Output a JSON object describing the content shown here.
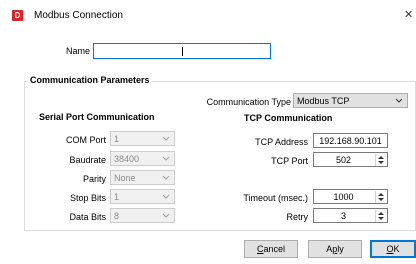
{
  "window": {
    "title": "Modbus Connection",
    "app_icon_letter": "D",
    "close_glyph": "✕"
  },
  "name_field": {
    "label": "Name",
    "value": ""
  },
  "comm_params": {
    "title": "Communication Parameters",
    "type_label": "Communication Type",
    "type_value": "Modbus TCP"
  },
  "serial": {
    "title": "Serial Port Communication",
    "com_port": {
      "label": "COM Port",
      "value": "1"
    },
    "baudrate": {
      "label": "Baudrate",
      "value": "38400"
    },
    "parity": {
      "label": "Parity",
      "value": "None"
    },
    "stop_bits": {
      "label": "Stop Bits",
      "value": "1"
    },
    "data_bits": {
      "label": "Data Bits",
      "value": "8"
    }
  },
  "tcp": {
    "title": "TCP Communication",
    "address": {
      "label": "TCP Address",
      "value": "192.168.90.101"
    },
    "port": {
      "label": "TCP Port",
      "value": "502"
    }
  },
  "timeout": {
    "label": "Timeout (msec.)",
    "value": "1000"
  },
  "retry": {
    "label": "Retry",
    "value": "3"
  },
  "buttons": {
    "cancel": {
      "mnemonic": "C",
      "rest": "ancel"
    },
    "apply": {
      "prefix": "Ap",
      "mnemonic": "p",
      "rest": "ly"
    },
    "ok": {
      "mnemonic": "O",
      "rest": "K"
    }
  },
  "colors": {
    "accent": "#0078d7",
    "app_icon": "#d8252c"
  }
}
